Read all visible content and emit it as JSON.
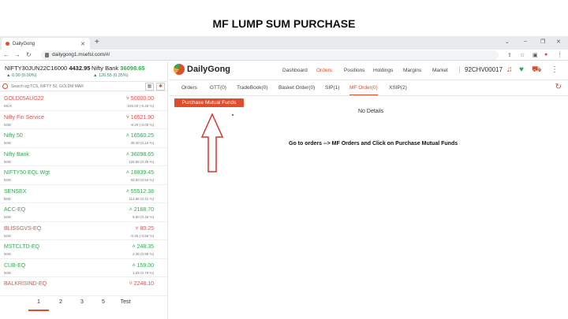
{
  "slide_title": "MF LUMP SUM PURCHASE",
  "browser": {
    "tab_title": "DailyGong",
    "url": "dailygong1.msefsl.com/#/"
  },
  "indices": [
    {
      "name": "NIFTY30JUN22C16000",
      "value": "4432.95",
      "change": "0.00 (0.00%)"
    },
    {
      "name": "Nifty Bank",
      "value": "36098.65",
      "change": "126.55 (0.35%)"
    }
  ],
  "search": {
    "placeholder": "Search eg:TCS, NIFTY 50, GOLDM MAR"
  },
  "watchlist": [
    {
      "symbol": "GOLD05AUG22",
      "exchange": "MCX",
      "ltp": "50000.00",
      "change": "-225.00 (-0.45 %)",
      "color": "red"
    },
    {
      "symbol": "Nifty Fin Service",
      "exchange": "NSE",
      "ltp": "16521.90",
      "change": "-8.20 (-0.05 %)",
      "color": "red"
    },
    {
      "symbol": "Nifty 50",
      "exchange": "NSE",
      "ltp": "16560.25",
      "change": "39.40 (0.24 %)",
      "color": "green"
    },
    {
      "symbol": "Nifty Bank",
      "exchange": "NSE",
      "ltp": "36098.65",
      "change": "126.55 (0.35 %)",
      "color": "green"
    },
    {
      "symbol": "NIFTY50 EQL Wgt",
      "exchange": "NSE",
      "ltp": "18839.45",
      "change": "93.50 (0.50 %)",
      "color": "green"
    },
    {
      "symbol": "SENSEX",
      "exchange": "BSE",
      "ltp": "55512.38",
      "change": "114.85 (0.21 %)",
      "color": "green"
    },
    {
      "symbol": "ACC-EQ",
      "exchange": "NSE",
      "ltp": "2168.70",
      "change": "9.80 (0.45 %)",
      "color": "green"
    },
    {
      "symbol": "BLISSGVS-EQ",
      "exchange": "NSE",
      "ltp": "80.25",
      "change": "-0.45 (-0.56 %)",
      "color": "red"
    },
    {
      "symbol": "MSTCLTD-EQ",
      "exchange": "NSE",
      "ltp": "248.35",
      "change": "2.35 (0.96 %)",
      "color": "green"
    },
    {
      "symbol": "CUB-EQ",
      "exchange": "NSE",
      "ltp": "159.00",
      "change": "1.25 (0.79 %)",
      "color": "green"
    },
    {
      "symbol": "BALKRISIND-EQ",
      "exchange": "",
      "ltp": "2248.10",
      "change": "",
      "color": "red"
    }
  ],
  "pager": [
    "1",
    "2",
    "3",
    "5",
    "Test"
  ],
  "logo_text": "DailyGong",
  "nav": [
    "Dashboard",
    "Orders",
    "Positions",
    "Holdings",
    "Margins",
    "Market"
  ],
  "client_id": "92CHV00017",
  "subtabs": [
    "Orders",
    "GTT(0)",
    "TradeBook(0)",
    "Basket Order(0)",
    "SIP(1)",
    "MF Order(0)",
    "XSIP(2)"
  ],
  "purchase_button": "Purchase Mutual Funds",
  "no_details": "No Details",
  "instruction": "Go to orders --> MF Orders and Click on Purchase Mutual Funds",
  "colors": {
    "accent": "#e04d2a",
    "up": "#3aa655",
    "down": "#d9534f"
  }
}
